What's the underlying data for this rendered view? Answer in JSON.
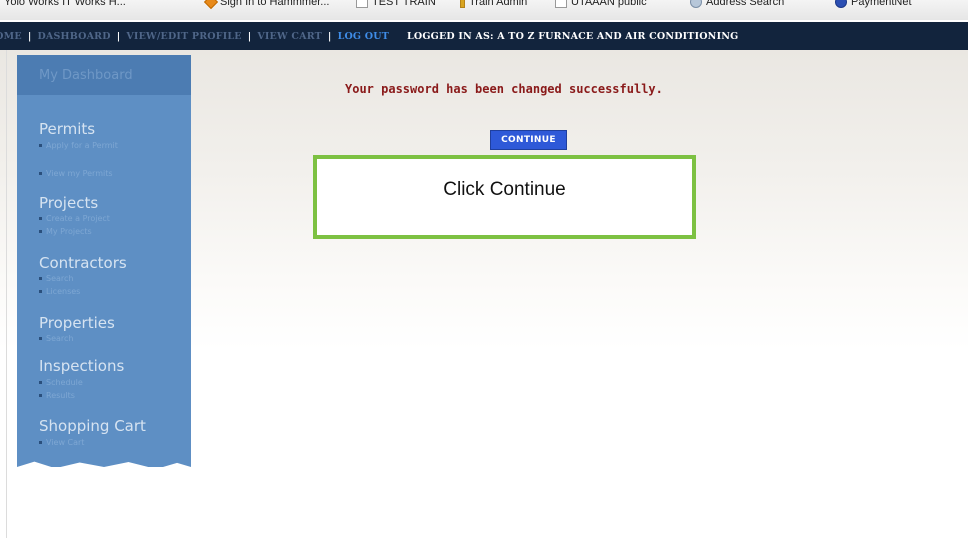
{
  "bookmarks": [
    {
      "icon": "page-icon",
      "label": "Yolo Works IT Works H..."
    },
    {
      "icon": "diamond-icon",
      "label": "Sign In to Hammmer..."
    },
    {
      "icon": "page-icon",
      "label": "TEST TRAIN"
    },
    {
      "icon": "pin-icon",
      "label": "Train Admin"
    },
    {
      "icon": "page-icon",
      "label": "UTAAAN public"
    },
    {
      "icon": "globe-icon",
      "label": "Address Search"
    },
    {
      "icon": "pay-icon",
      "label": "PaymentNet"
    }
  ],
  "nav": {
    "home": "HOME",
    "dashboard": "DASHBOARD",
    "profile": "VIEW/EDIT PROFILE",
    "cart": "VIEW CART",
    "logout": "LOG OUT",
    "logged_in": "LOGGED IN AS:  A TO Z FURNACE AND AIR CONDITIONING"
  },
  "sidebar": {
    "header": "My Dashboard",
    "items": [
      {
        "label": "Permits",
        "subs": [
          "Apply for a Permit",
          "View my Permits"
        ]
      },
      {
        "label": "Projects",
        "subs": [
          "Create a Project",
          "My Projects"
        ]
      },
      {
        "label": "Contractors",
        "subs": [
          "Search",
          "Licenses"
        ]
      },
      {
        "label": "Properties",
        "subs": [
          "Search"
        ]
      },
      {
        "label": "Inspections",
        "subs": [
          "Schedule",
          "Results"
        ]
      },
      {
        "label": "Shopping Cart",
        "subs": [
          "View Cart"
        ]
      }
    ]
  },
  "main": {
    "message": "Your password has been changed successfully.",
    "continue_label": "CONTINUE",
    "callout": "Click Continue"
  },
  "colors": {
    "nav_bg": "#12243d",
    "sidebar": "#5e8fc4",
    "message": "#8a1a1a",
    "button": "#2e59d8",
    "callout_border": "#7dc142"
  }
}
